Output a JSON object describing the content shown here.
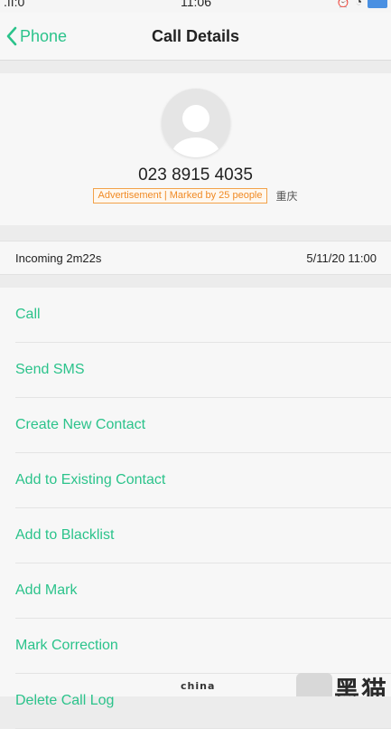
{
  "status_bar": {
    "carrier": ".ıı:0",
    "time": "11:06",
    "icons": [
      "alarm-icon",
      "wifi-icon",
      "battery-icon"
    ]
  },
  "nav": {
    "back_label": "Phone",
    "title": "Call Details"
  },
  "contact": {
    "number": "023 8915 4035",
    "tag": "Advertisement | Marked by 25 people",
    "location": "重庆"
  },
  "call_info": {
    "type_duration": "Incoming  2m22s",
    "date_time": "5/11/20 11:00"
  },
  "actions": [
    {
      "label": "Call"
    },
    {
      "label": "Send SMS"
    },
    {
      "label": "Create New Contact"
    },
    {
      "label": "Add to Existing Contact"
    },
    {
      "label": "Add to Blacklist"
    },
    {
      "label": "Add Mark"
    },
    {
      "label": "Mark Correction"
    },
    {
      "label": "Delete Call Log"
    }
  ],
  "watermark": {
    "text": "china",
    "logo": "黑猫"
  },
  "colors": {
    "accent": "#2bc38b",
    "tag": "#f08a24",
    "background": "#ececec",
    "surface": "#f7f7f7"
  }
}
